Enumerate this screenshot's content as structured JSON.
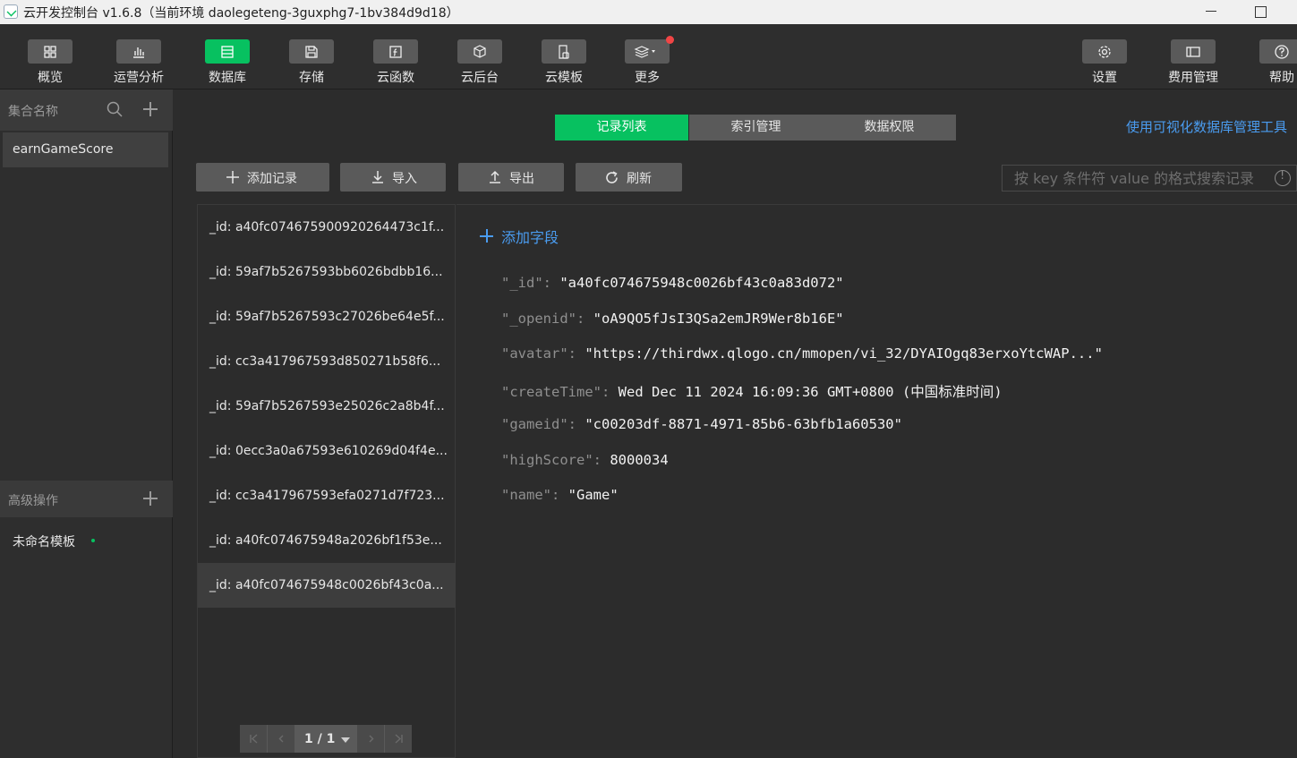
{
  "window": {
    "title": "云开发控制台 v1.6.8（当前环境 daolegeteng-3guxphg7-1bv384d9d18）"
  },
  "toolbar": {
    "items": [
      {
        "label": "概览",
        "icon": "grid-icon"
      },
      {
        "label": "运营分析",
        "icon": "bar-chart-icon"
      },
      {
        "label": "数据库",
        "icon": "database-icon"
      },
      {
        "label": "存储",
        "icon": "save-icon"
      },
      {
        "label": "云函数",
        "icon": "function-icon"
      },
      {
        "label": "云后台",
        "icon": "cube-icon"
      },
      {
        "label": "云模板",
        "icon": "template-icon"
      },
      {
        "label": "更多",
        "icon": "layers-icon"
      }
    ],
    "right_items": [
      {
        "label": "设置",
        "icon": "gear-icon"
      },
      {
        "label": "费用管理",
        "icon": "billing-icon"
      },
      {
        "label": "帮助",
        "icon": "help-icon"
      }
    ],
    "active": "数据库"
  },
  "sidebar": {
    "collections_header": "集合名称",
    "collections": [
      "earnGameScore"
    ],
    "advanced_header": "高级操作",
    "templates": [
      "未命名模板"
    ]
  },
  "tabs": [
    "记录列表",
    "索引管理",
    "数据权限"
  ],
  "visual_link": "使用可视化数据库管理工具",
  "actions": {
    "add": "添加记录",
    "import": "导入",
    "export": "导出",
    "refresh": "刷新"
  },
  "search": {
    "placeholder": "按 key 条件符 value 的格式搜索记录"
  },
  "records": [
    "_id: a40fc074675900920264473c1f...",
    "_id: 59af7b5267593bb6026bdbb16...",
    "_id: 59af7b5267593c27026be64e5f...",
    "_id: cc3a417967593d850271b58f6...",
    "_id: 59af7b5267593e25026c2a8b4f...",
    "_id: 0ecc3a0a67593e610269d04f4e...",
    "_id: cc3a417967593efa0271d7f723...",
    "_id: a40fc074675948a2026bf1f53e...",
    "_id: a40fc074675948c0026bf43c0a..."
  ],
  "pager": {
    "text": "1 / 1"
  },
  "detail": {
    "add_field": "添加字段",
    "fields": [
      {
        "key": "\"_id\":",
        "value": "\"a40fc074675948c0026bf43c0a83d072\""
      },
      {
        "key": "\"_openid\":",
        "value": "\"oA9QO5fJsI3QSa2emJR9Wer8b16E\""
      },
      {
        "key": "\"avatar\":",
        "value": "\"https://thirdwx.qlogo.cn/mmopen/vi_32/DYAIOgq83erxoYtcWAP...\""
      },
      {
        "key": "\"createTime\":",
        "value": "Wed Dec 11 2024 16:09:36 GMT+0800 (中国标准时间)"
      },
      {
        "key": "\"gameid\":",
        "value": "\"c00203df-8871-4971-85b6-63bfb1a60530\""
      },
      {
        "key": "\"highScore\":",
        "value": "8000034"
      },
      {
        "key": "\"name\":",
        "value": "\"Game\""
      }
    ]
  },
  "colors": {
    "accent": "#07c160",
    "link": "#4a9cf0",
    "background": "#2c2c2c"
  }
}
